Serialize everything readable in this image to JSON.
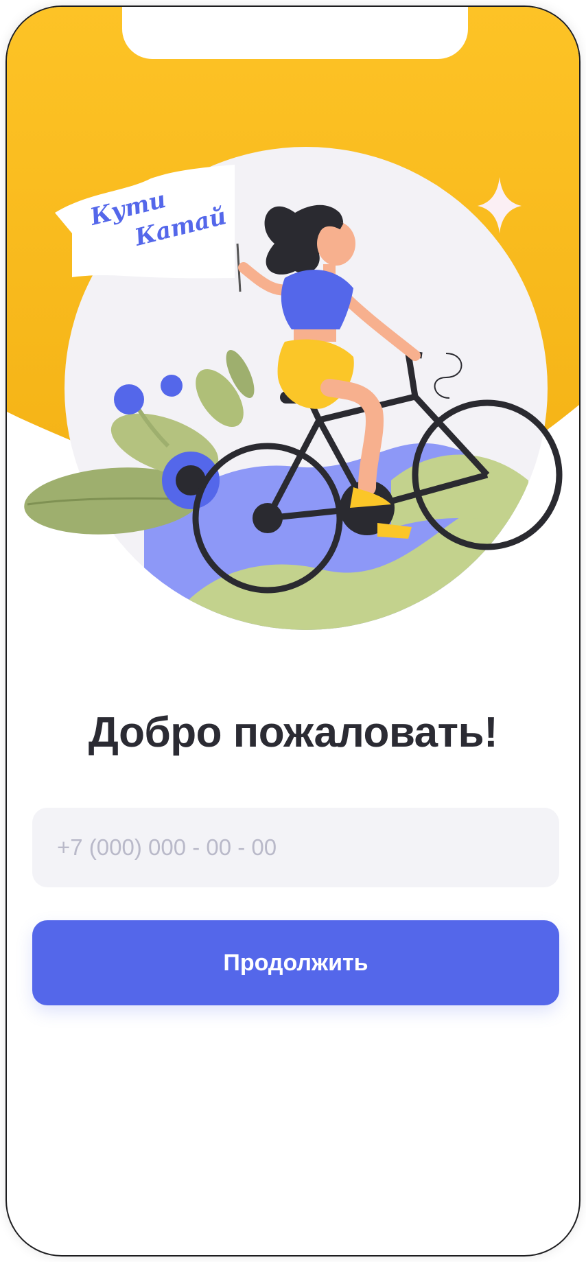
{
  "hero": {
    "flag_text_line1": "Кути",
    "flag_text_line2": "Катай",
    "illustration": "girl-on-bicycle-illustration"
  },
  "welcome": {
    "title": "Добро пожаловать!"
  },
  "phone_field": {
    "value": "",
    "placeholder": "+7 (000) 000 - 00 - 00"
  },
  "continue_button": {
    "label": "Продолжить"
  },
  "colors": {
    "hero_yellow": "#FBC02D",
    "primary": "#5467EA",
    "input_bg": "#F3F3F7",
    "title": "#2B2B33"
  }
}
